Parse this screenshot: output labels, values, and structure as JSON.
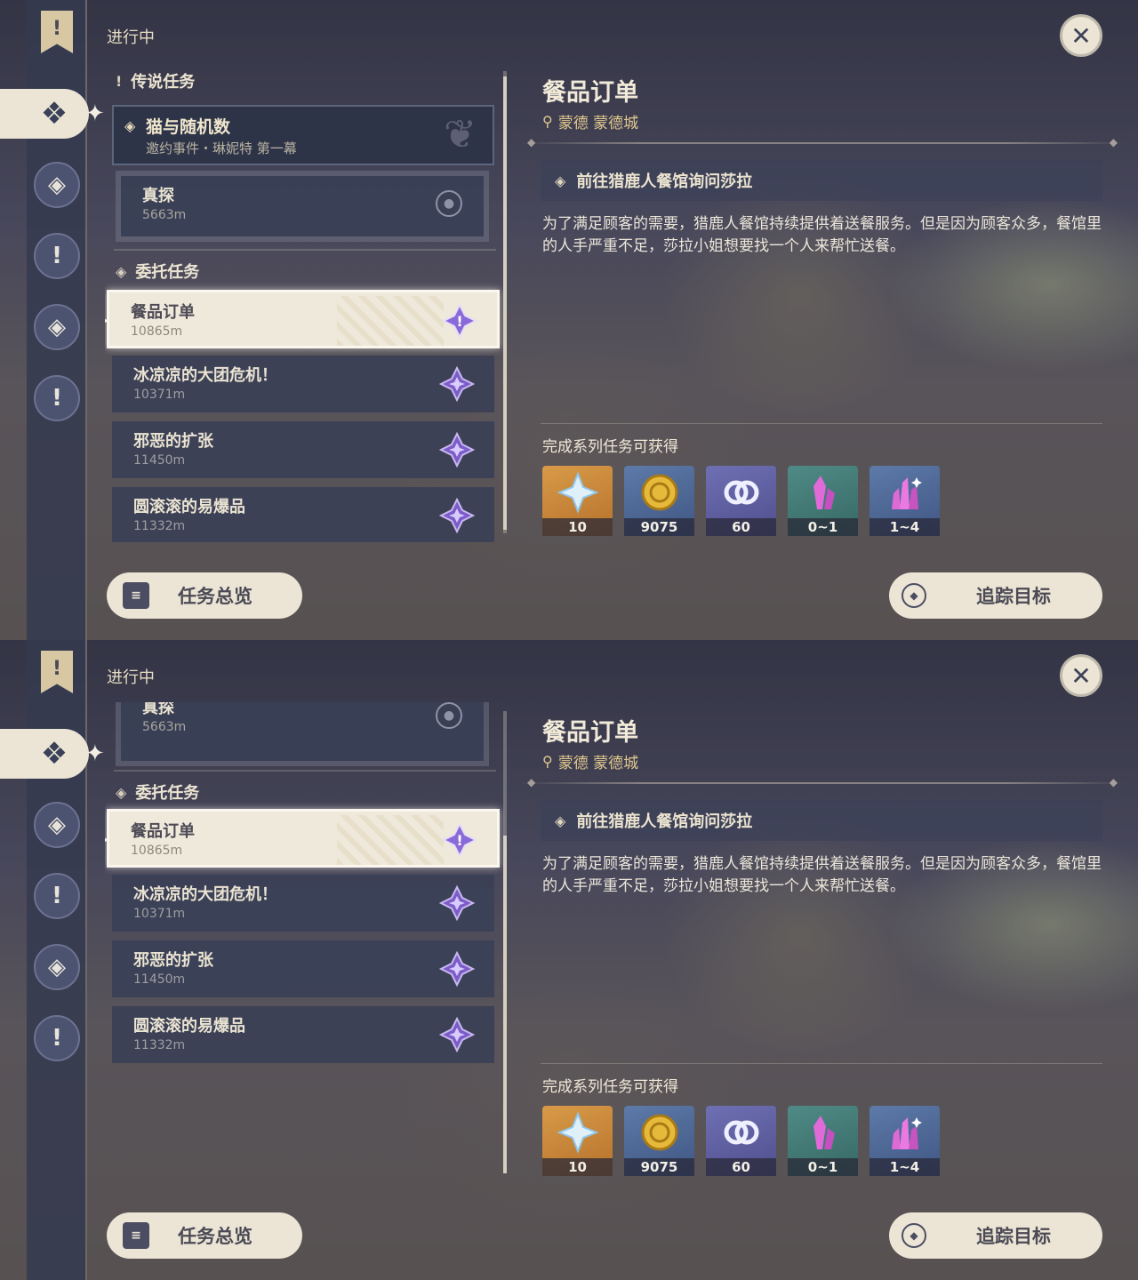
{
  "screens": [
    {
      "header": {
        "section": "进行中"
      },
      "legend": {
        "category": "传说任务",
        "title": "猫与随机数",
        "subtitle": "邀约事件・琳妮特 第一幕",
        "sub_quest": {
          "title": "真探",
          "distance": "5663m"
        }
      },
      "commission": {
        "category": "委托任务",
        "tasks": [
          {
            "title": "餐品订单",
            "distance": "10865m"
          },
          {
            "title": "冰凉凉的大团危机！",
            "distance": "10371m"
          },
          {
            "title": "邪恶的扩张",
            "distance": "11450m"
          },
          {
            "title": "圆滚滚的易爆品",
            "distance": "11332m"
          }
        ]
      }
    },
    {
      "header": {
        "section": "进行中"
      },
      "legend": {
        "sub_quest": {
          "title": "真探",
          "distance": "5663m"
        }
      },
      "commission": {
        "category": "委托任务",
        "tasks": [
          {
            "title": "餐品订单",
            "distance": "10865m"
          },
          {
            "title": "冰凉凉的大团危机！",
            "distance": "10371m"
          },
          {
            "title": "邪恶的扩张",
            "distance": "11450m"
          },
          {
            "title": "圆滚滚的易爆品",
            "distance": "11332m"
          }
        ]
      }
    }
  ],
  "detail": {
    "title": "餐品订单",
    "location": "蒙德 蒙德城",
    "goal": "前往猎鹿人餐馆询问莎拉",
    "description": "为了满足顾客的需要，猎鹿人餐馆持续提供着送餐服务。但是因为顾客众多，餐馆里的人手严重不足，莎拉小姐想要找一个人来帮忙送餐。",
    "reward_label": "完成系列任务可获得",
    "rewards": [
      {
        "icon": "primogem-icon",
        "count": "10"
      },
      {
        "icon": "mora-icon",
        "count": "9075"
      },
      {
        "icon": "adventure-exp-icon",
        "count": "60"
      },
      {
        "icon": "crystal-icon",
        "count": "0~1"
      },
      {
        "icon": "crystal-cluster-icon",
        "count": "1~4"
      }
    ]
  },
  "buttons": {
    "overview": "任务总览",
    "track": "追踪目标"
  },
  "colors": {
    "selected_card": "#efe9dc",
    "card": "#3a4056",
    "accent_gold": "#e2c88e",
    "star_purple": "#8a6ad8"
  }
}
